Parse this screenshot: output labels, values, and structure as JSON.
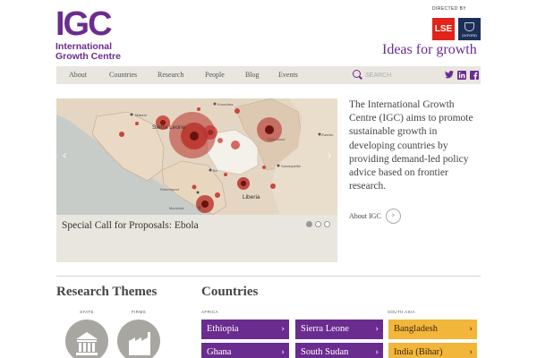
{
  "header": {
    "logo_mark": "IGC",
    "logo_line1": "International",
    "logo_line2": "Growth Centre",
    "directed_by": "DIRECTED BY",
    "lse_label": "LSE",
    "oxford_label": "OXFORD",
    "tagline": "Ideas for growth"
  },
  "nav": {
    "items": [
      {
        "label": "About"
      },
      {
        "label": "Countries"
      },
      {
        "label": "Research"
      },
      {
        "label": "People"
      },
      {
        "label": "Blog"
      },
      {
        "label": "Events"
      }
    ]
  },
  "search": {
    "placeholder": "SEARCH",
    "icon": "search-icon"
  },
  "social": {
    "twitter": "twitter-icon",
    "linkedin": "linkedin-icon",
    "facebook": "facebook-icon"
  },
  "slider": {
    "caption": "Special Call for Proposals: Ebola",
    "map_labels": {
      "sierra_leone": "Sierra Leone",
      "liberia": "Liberia",
      "koundara": "Koundara",
      "makeni": "Makeni",
      "bo": "Bo",
      "robertsport": "Robertsport",
      "monrovia": "Monrovia",
      "zwedru": "Zwedru",
      "sanniquellie": "Sanniquellie",
      "nzerekore": "N'Zerekore"
    }
  },
  "intro": {
    "text": "The International Growth Centre (IGC) aims to promote sustainable growth in developing countries by providing demand-led policy advice based on frontier research.",
    "link_label": "About IGC"
  },
  "research_themes": {
    "title": "Research Themes",
    "themes": [
      {
        "label": "STATE",
        "icon": "building-icon"
      },
      {
        "label": "FIRMS",
        "icon": "factory-icon"
      }
    ]
  },
  "countries": {
    "title": "Countries",
    "regions": [
      {
        "name": "AFRICA"
      },
      {
        "name": "SOUTH ASIA"
      }
    ],
    "items": [
      {
        "label": "Ethiopia"
      },
      {
        "label": "Sierra Leone"
      },
      {
        "label": "Bangladesh"
      },
      {
        "label": "Ghana"
      },
      {
        "label": "South Sudan"
      },
      {
        "label": "India (Bihar)"
      }
    ]
  },
  "colors": {
    "brand_purple": "#6b2c8f",
    "gold": "#f2b63a",
    "lse_red": "#e2231a",
    "oxford_navy": "#1c2f57"
  }
}
